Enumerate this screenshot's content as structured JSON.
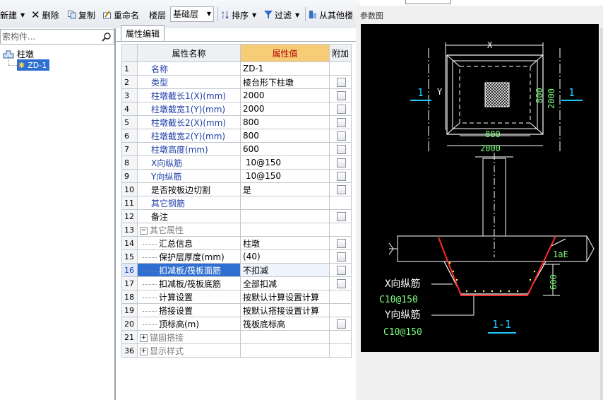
{
  "toolbar": {
    "new_label": "新建",
    "delete_label": "删除",
    "copy_label": "复制",
    "rename_label": "重命名",
    "floor_label": "楼层",
    "floor_value": "基础层",
    "sort_label": "排序",
    "filter_label": "过滤",
    "from_other_label": "从其他楼"
  },
  "search": {
    "placeholder": "索构件..."
  },
  "tree": {
    "root_label": "柱墩",
    "child_label": "ZD-1"
  },
  "property_editor": {
    "tab_label": "属性编辑",
    "headers": {
      "num": "",
      "name": "属性名称",
      "value": "属性值",
      "extra": "附加"
    },
    "rows": [
      {
        "num": "1",
        "name": "名称",
        "value": "ZD-1",
        "style": "blue",
        "check": false,
        "kind": "plain"
      },
      {
        "num": "2",
        "name": "类型",
        "value": "棱台形下柱墩",
        "style": "blue",
        "check": true,
        "kind": "plain"
      },
      {
        "num": "3",
        "name": "柱墩截长1(X)(mm)",
        "value": "2000",
        "style": "blue",
        "check": true,
        "kind": "plain"
      },
      {
        "num": "4",
        "name": "柱墩截宽1(Y)(mm)",
        "value": "2000",
        "style": "blue",
        "check": true,
        "kind": "plain"
      },
      {
        "num": "5",
        "name": "柱墩截长2(X)(mm)",
        "value": "800",
        "style": "blue",
        "check": true,
        "kind": "plain"
      },
      {
        "num": "6",
        "name": "柱墩截宽2(Y)(mm)",
        "value": "800",
        "style": "blue",
        "check": true,
        "kind": "plain"
      },
      {
        "num": "7",
        "name": "柱墩高度(mm)",
        "value": "600",
        "style": "blue",
        "check": true,
        "kind": "plain"
      },
      {
        "num": "8",
        "name": "X向纵筋",
        "value": " 10@150",
        "style": "blue",
        "check": true,
        "kind": "plain"
      },
      {
        "num": "9",
        "name": "Y向纵筋",
        "value": " 10@150",
        "style": "blue",
        "check": true,
        "kind": "plain"
      },
      {
        "num": "10",
        "name": "是否按板边切割",
        "value": "是",
        "style": "black",
        "check": true,
        "kind": "plain"
      },
      {
        "num": "11",
        "name": "其它钢筋",
        "value": "",
        "style": "blue",
        "check": false,
        "kind": "plain"
      },
      {
        "num": "12",
        "name": "备注",
        "value": "",
        "style": "black",
        "check": true,
        "kind": "plain"
      },
      {
        "num": "13",
        "name": "其它属性",
        "value": "",
        "style": "gray",
        "check": false,
        "kind": "minus"
      },
      {
        "num": "14",
        "name": "汇总信息",
        "value": "柱墩",
        "style": "black",
        "check": true,
        "kind": "child"
      },
      {
        "num": "15",
        "name": "保护层厚度(mm)",
        "value": "(40)",
        "style": "black",
        "check": true,
        "kind": "child"
      },
      {
        "num": "16",
        "name": "扣减板/筏板面筋",
        "value": "不扣减",
        "style": "black",
        "check": true,
        "kind": "child",
        "selected": true
      },
      {
        "num": "17",
        "name": "扣减板/筏板底筋",
        "value": "全部扣减",
        "style": "black",
        "check": true,
        "kind": "child"
      },
      {
        "num": "18",
        "name": "计算设置",
        "value": "按默认计算设置计算",
        "style": "black",
        "check": false,
        "kind": "child"
      },
      {
        "num": "19",
        "name": "搭接设置",
        "value": "按默认搭接设置计算",
        "style": "black",
        "check": false,
        "kind": "child"
      },
      {
        "num": "20",
        "name": "顶标高(m)",
        "value": "筏板底标高",
        "style": "black",
        "check": true,
        "kind": "child"
      },
      {
        "num": "21",
        "name": "锚固搭接",
        "value": "",
        "style": "gray",
        "check": false,
        "kind": "plus"
      },
      {
        "num": "36",
        "name": "显示样式",
        "value": "",
        "style": "gray",
        "check": false,
        "kind": "plus"
      }
    ]
  },
  "param_panel": {
    "title": "参数图",
    "drawing": {
      "dim_x": "X",
      "dim_y": "Y",
      "dim_inner_bottom": "800",
      "dim_outer_bottom": "2000",
      "dim_inner_right": "800",
      "dim_outer_right": "2000",
      "section_mark": "1",
      "lae_label": "1aE",
      "height_dim": "600",
      "x_rebar_label": "X向纵筋",
      "x_rebar_value": "C10@150",
      "y_rebar_label": "Y向纵筋",
      "y_rebar_value": "C10@150",
      "section_title": "1-1"
    }
  }
}
